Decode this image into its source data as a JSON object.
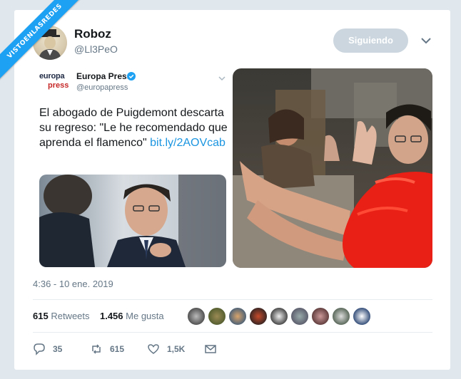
{
  "watermark": "VISTOENLASREDES",
  "author": {
    "name": "Roboz",
    "handle": "@Ll3PeO"
  },
  "follow_button": "Siguiendo",
  "quoted": {
    "logo_top": "europa",
    "logo_bottom": "press",
    "name": "Europa Press",
    "handle": "@europapress",
    "text": "El abogado de Puigdemont descarta su regreso: \"Le he recomendado que aprenda el flamenco\" ",
    "link": "bit.ly/2AOVcab"
  },
  "timestamp": "4:36 - 10 ene. 2019",
  "stats": {
    "retweets_count": "615",
    "retweets_label": "Retweets",
    "likes_count": "1.456",
    "likes_label": "Me gusta"
  },
  "actions": {
    "replies": "35",
    "retweets": "615",
    "likes": "1,5K"
  },
  "colors": {
    "accent": "#1da1f2",
    "link": "#1b95e0",
    "muted": "#657786",
    "follow_bg": "#cbd6de"
  },
  "icons": [
    "verified-badge-icon",
    "chevron-down-icon",
    "reply-icon",
    "retweet-icon",
    "heart-icon",
    "envelope-icon"
  ]
}
